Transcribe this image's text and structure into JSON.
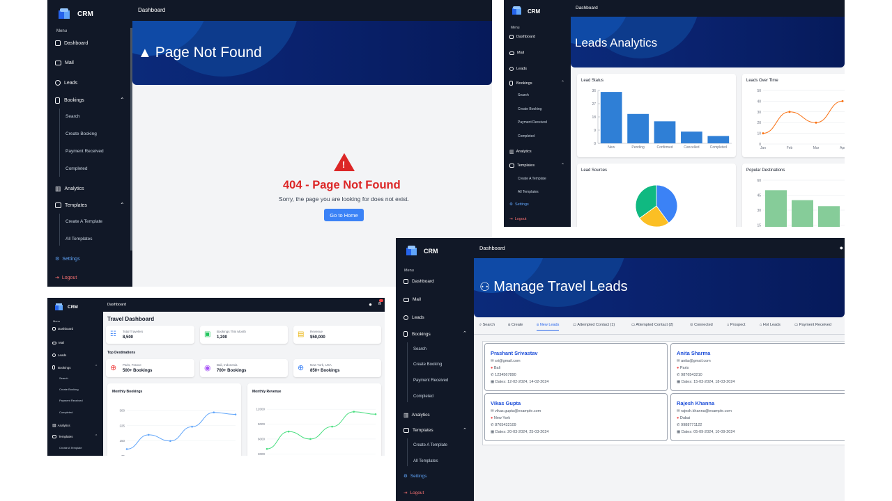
{
  "colors": {
    "sidebar": "#111827",
    "accent": "#3b82f6",
    "error": "#dc2626",
    "hero": "#0a2370"
  },
  "brand": "CRM",
  "menu_label": "Menu",
  "nav": {
    "dashboard": "Dashboard",
    "mail": "Mail",
    "leads": "Leads",
    "bookings": "Bookings",
    "bookings_sub": [
      "Search",
      "Create Booking",
      "Payment Received",
      "Completed"
    ],
    "analytics": "Analytics",
    "templates": "Templates",
    "templates_sub": [
      "Create A Template",
      "All Templates"
    ],
    "settings": "Settings",
    "logout": "Logout"
  },
  "topbar_title": "Dashboard",
  "page404": {
    "hero_title": "Page Not Found",
    "heading": "404 - Page Not Found",
    "message": "Sorry, the page you are looking for does not exist.",
    "button": "Go to Home"
  },
  "analytics": {
    "hero_title": "Leads Analytics",
    "cards": {
      "status": "Lead Status",
      "over_time": "Leads Over Time",
      "sources": "Lead Sources",
      "destinations": "Popular Destinations"
    }
  },
  "chart_data": [
    {
      "type": "bar",
      "title": "Lead Status",
      "categories": [
        "New",
        "Pending",
        "Confirmed",
        "Cancelled",
        "Completed"
      ],
      "values": [
        35,
        20,
        15,
        8,
        5
      ],
      "yticks": [
        0,
        9,
        18,
        27,
        36
      ],
      "ylim": [
        0,
        36
      ]
    },
    {
      "type": "line",
      "title": "Leads Over Time",
      "categories": [
        "Jan",
        "Feb",
        "Mar",
        "Apr"
      ],
      "values": [
        10,
        30,
        20,
        40
      ],
      "yticks": [
        0,
        10,
        20,
        30,
        40,
        50
      ],
      "ylim": [
        0,
        50
      ]
    },
    {
      "type": "pie",
      "title": "Lead Sources",
      "values": [
        40,
        25,
        35
      ],
      "colors": [
        "#3b82f6",
        "#fbbf24",
        "#10b981"
      ]
    },
    {
      "type": "bar",
      "title": "Popular Destinations",
      "values": [
        50,
        40,
        34
      ],
      "yticks": [
        15,
        30,
        45,
        60
      ],
      "ylim": [
        0,
        60
      ]
    },
    {
      "type": "line",
      "title": "Monthly Bookings",
      "values": [
        110,
        180,
        150,
        220,
        290,
        280
      ],
      "yticks": [
        75,
        150,
        225,
        300
      ],
      "ylim": [
        50,
        330
      ]
    },
    {
      "type": "line",
      "title": "Monthly Revenue",
      "values": [
        4000,
        7500,
        6000,
        8500,
        11500,
        11000
      ],
      "yticks": [
        3000,
        6000,
        9000,
        12000
      ],
      "ylim": [
        1500,
        13000
      ]
    }
  ],
  "travel": {
    "title": "Travel Dashboard",
    "stats": [
      {
        "label": "Total Travelers",
        "value": "8,500"
      },
      {
        "label": "Bookings This Month",
        "value": "1,200"
      },
      {
        "label": "Revenue",
        "value": "$50,000"
      }
    ],
    "top_dest_label": "Top Destinations",
    "destinations": [
      {
        "place": "Paris, France",
        "value": "500+ Bookings"
      },
      {
        "place": "Bali, Indonesia",
        "value": "700+ Bookings"
      },
      {
        "place": "New York, USA",
        "value": "850+ Bookings"
      }
    ],
    "monthly_bookings": "Monthly Bookings",
    "monthly_revenue": "Monthly Revenue"
  },
  "manage": {
    "hero_title": "Manage Travel Leads",
    "tabs": [
      "Search",
      "Create",
      "New Leads",
      "Attempted Contact (1)",
      "Attempted Contact (2)",
      "Connected",
      "Prospect",
      "Hot Leads",
      "Payment Received"
    ],
    "leads": [
      {
        "name": "Prashant Srivastav",
        "email": "sri@gmail.com",
        "place": "Bali",
        "phone": "1234567890",
        "dates": "Dates: 12-02-2024, 14-02-2024"
      },
      {
        "name": "Anita Sharma",
        "email": "anita@gmail.com",
        "place": "Paris",
        "phone": "9876543210",
        "dates": "Dates: 15-03-2024, 18-03-2024"
      },
      {
        "name": "Vikas Gupta",
        "email": "vikas.gupta@example.com",
        "place": "New York",
        "phone": "8765432109",
        "dates": "Dates: 20-03-2024, 25-03-2024"
      },
      {
        "name": "Rajesh Khanna",
        "email": "rajesh.khanna@example.com",
        "place": "Dubai",
        "phone": "9988771122",
        "dates": "Dates: 05-09-2024, 10-09-2024"
      }
    ]
  }
}
